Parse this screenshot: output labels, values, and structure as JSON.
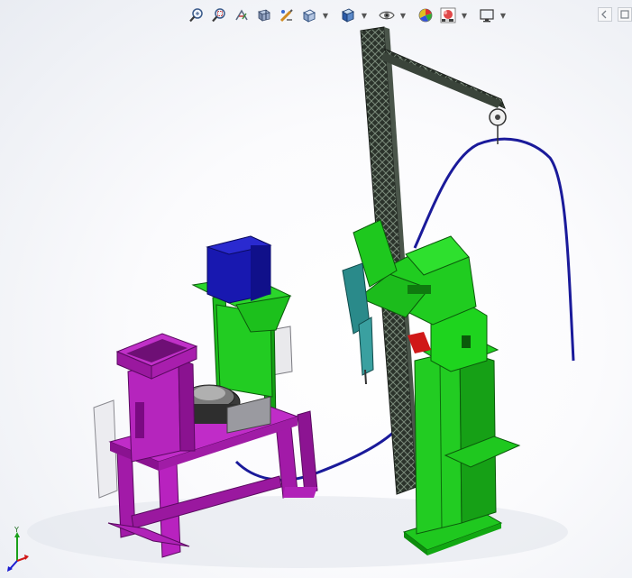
{
  "viewport": {
    "background_top": "#ffffff",
    "background_edge": "#e9ecf2"
  },
  "toolbar": {
    "items": [
      {
        "name": "zoom-to-fit",
        "icon": "zoom-to-fit-icon"
      },
      {
        "name": "zoom-to-area",
        "icon": "zoom-to-area-icon"
      },
      {
        "name": "previous-view",
        "icon": "previous-view-icon"
      },
      {
        "name": "section-view",
        "icon": "section-view-icon"
      },
      {
        "name": "dynamic-annotation",
        "icon": "dynamic-annotation-icon"
      },
      {
        "name": "view-orientation",
        "icon": "view-orientation-icon",
        "has_menu": true
      },
      {
        "name": "display-style",
        "icon": "display-style-icon",
        "has_menu": true
      },
      {
        "name": "hide-show-items",
        "icon": "hide-show-icon",
        "has_menu": true
      },
      {
        "name": "edit-appearance",
        "icon": "edit-appearance-icon"
      },
      {
        "name": "apply-scene",
        "icon": "apply-scene-icon",
        "has_menu": true
      },
      {
        "name": "view-settings",
        "icon": "view-settings-icon",
        "has_menu": true
      }
    ]
  },
  "corner_controls": [
    {
      "name": "restore-window",
      "icon": "restore-window-icon"
    },
    {
      "name": "maximize-window",
      "icon": "maximize-window-icon"
    }
  ],
  "model": {
    "colors": {
      "magenta_station": "#b022b8",
      "magenta_dark": "#6e0f75",
      "green_parts": "#1fc81f",
      "green_dark": "#0b7a0b",
      "blue_hopper": "#1717a8",
      "column_dark": "#2a2f2a",
      "cable_blue": "#1a1a9a",
      "red_accent": "#d01818",
      "gray_panel": "#e8e8ea"
    }
  },
  "triad": {
    "axes": [
      "Y",
      "X",
      "Z"
    ],
    "colors": {
      "x": "#d01818",
      "y": "#1aa01a",
      "z": "#1a1ad0"
    }
  }
}
